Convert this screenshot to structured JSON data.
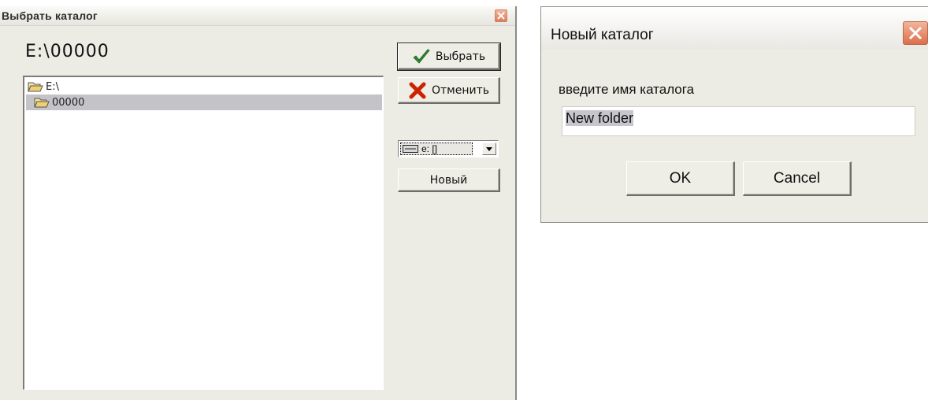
{
  "choose_dialog": {
    "title": "Выбрать каталог",
    "current_path": "E:\\00000",
    "tree": {
      "root": "E:\\",
      "child": "00000"
    },
    "buttons": {
      "choose": "Выбрать",
      "cancel": "Отменить",
      "new": "Новый"
    },
    "drive_select": {
      "selected": "e: []"
    }
  },
  "new_folder_dialog": {
    "title": "Новый каталог",
    "prompt": "введите имя каталога",
    "input_value": "New folder",
    "buttons": {
      "ok": "OK",
      "cancel": "Cancel"
    }
  },
  "colors": {
    "dialog_bg": "#ecebe4",
    "selection_bg": "#c4c3c8",
    "close_button": "#e07a57",
    "check_icon": "#2e8b2e",
    "cancel_icon": "#cc2200",
    "folder_icon": "#f0d070"
  }
}
